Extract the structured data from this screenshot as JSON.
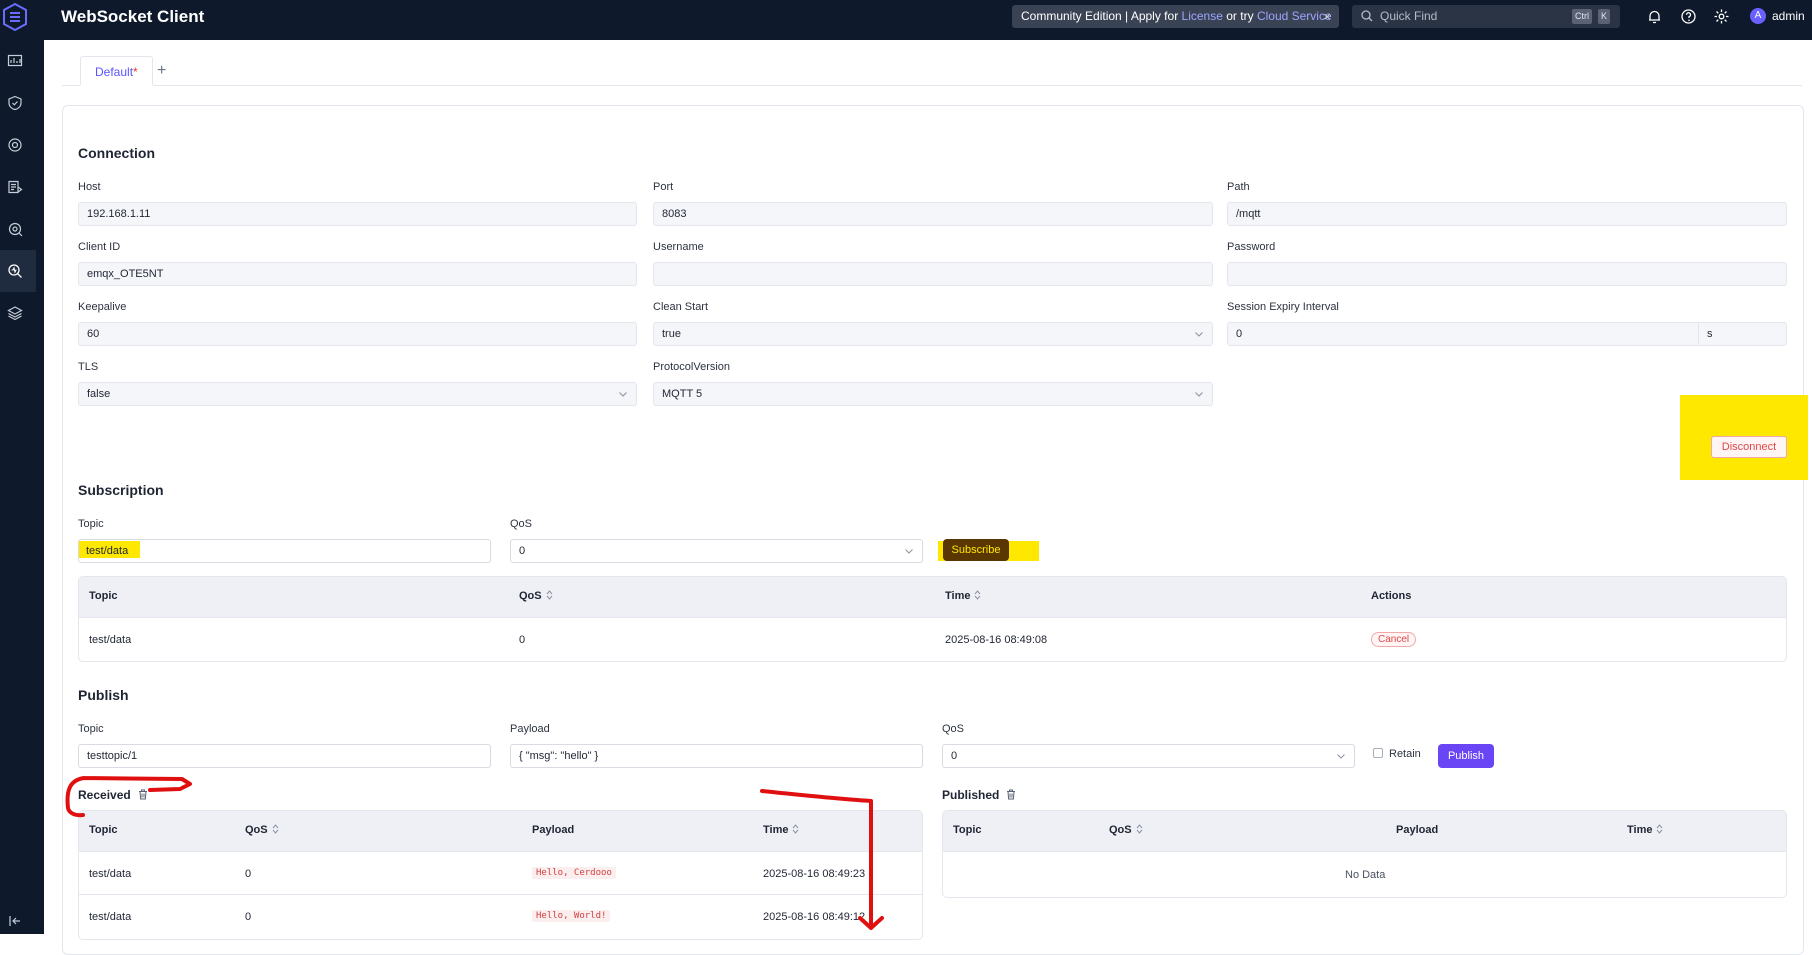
{
  "app": {
    "title": "WebSocket Client"
  },
  "topbar": {
    "banner": {
      "prefix": "Community Edition | Apply for",
      "license": "License",
      "or_try": "or try",
      "cloud": "Cloud Service",
      "close": "×"
    },
    "quickfind": {
      "placeholder": "Quick Find",
      "key_ctrl": "Ctrl",
      "key_k": "K"
    },
    "user": {
      "avatar": "A",
      "name": "admin"
    }
  },
  "sidebar": {
    "items": [
      "dashboard-icon",
      "shield-icon",
      "connections-icon",
      "rules-icon",
      "management-icon",
      "diagnose-icon",
      "layers-icon"
    ],
    "active_index": 5
  },
  "tabs": [
    {
      "label": "Default",
      "modified_mark": "*"
    }
  ],
  "tab_add": "+",
  "connection": {
    "title": "Connection",
    "host": {
      "label": "Host",
      "value": "192.168.1.11"
    },
    "port": {
      "label": "Port",
      "value": "8083"
    },
    "path": {
      "label": "Path",
      "value": "/mqtt"
    },
    "client_id": {
      "label": "Client ID",
      "value": "emqx_OTE5NT"
    },
    "username": {
      "label": "Username",
      "value": ""
    },
    "password": {
      "label": "Password",
      "value": ""
    },
    "keepalive": {
      "label": "Keepalive",
      "value": "60"
    },
    "clean_start": {
      "label": "Clean Start",
      "value": "true"
    },
    "session_expiry": {
      "label": "Session Expiry Interval",
      "value": "0",
      "unit": "s"
    },
    "tls": {
      "label": "TLS",
      "value": "false"
    },
    "protocol_version": {
      "label": "ProtocolVersion",
      "value": "MQTT 5"
    },
    "disconnect_label": "Disconnect"
  },
  "subscription": {
    "title": "Subscription",
    "topic": {
      "label": "Topic",
      "value": "test/data"
    },
    "qos": {
      "label": "QoS",
      "value": "0"
    },
    "subscribe_label": "Subscribe",
    "table": {
      "headers": [
        "Topic",
        "QoS",
        "Time",
        "Actions"
      ],
      "rows": [
        {
          "topic": "test/data",
          "qos": "0",
          "time": "2025-08-16 08:49:08",
          "action": "Cancel"
        }
      ]
    }
  },
  "publish": {
    "title": "Publish",
    "topic": {
      "label": "Topic",
      "value": "testtopic/1"
    },
    "payload": {
      "label": "Payload",
      "value": "{ \"msg\": \"hello\" }"
    },
    "qos": {
      "label": "QoS",
      "value": "0"
    },
    "retain_label": "Retain",
    "publish_label": "Publish"
  },
  "received": {
    "title": "Received",
    "headers": [
      "Topic",
      "QoS",
      "Payload",
      "Time"
    ],
    "rows": [
      {
        "topic": "test/data",
        "qos": "0",
        "payload": "Hello, Cerdooo",
        "time": "2025-08-16 08:49:23"
      },
      {
        "topic": "test/data",
        "qos": "0",
        "payload": "Hello, World!",
        "time": "2025-08-16 08:49:12"
      }
    ]
  },
  "published": {
    "title": "Published",
    "headers": [
      "Topic",
      "QoS",
      "Payload",
      "Time"
    ],
    "empty_text": "No Data"
  },
  "colors": {
    "accent": "#6a45f5",
    "danger": "#e04848",
    "highlight": "#ffe800",
    "annotation": "#e01010",
    "nav_bg": "#0e1a2b"
  }
}
